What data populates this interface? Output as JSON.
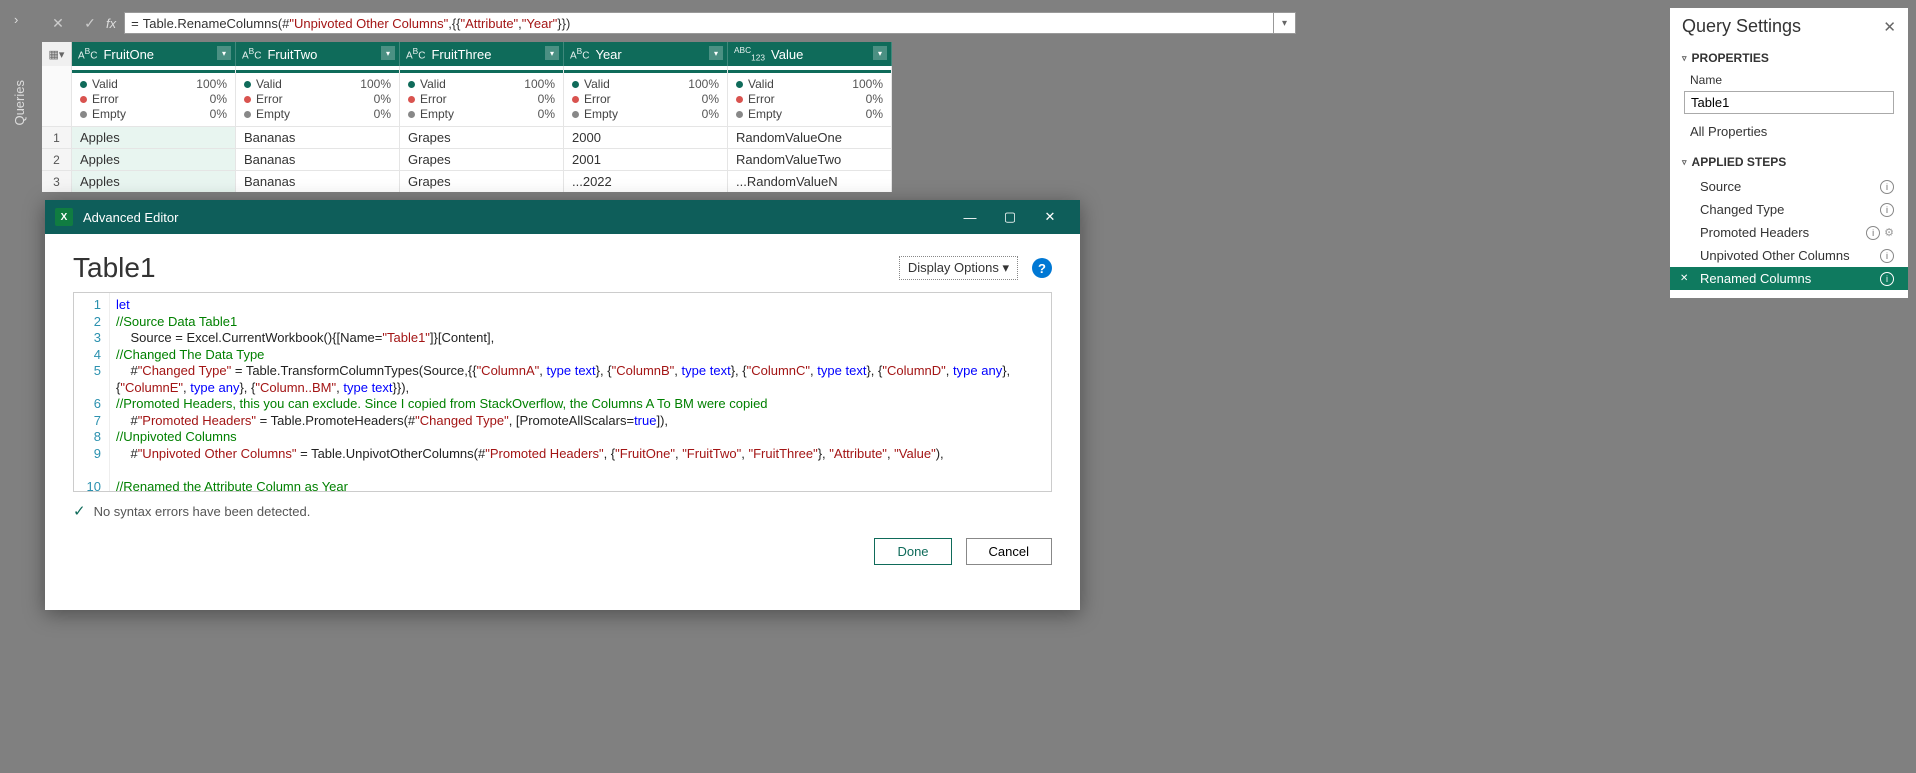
{
  "sidebar": {
    "queries_label": "Queries"
  },
  "formula_bar": {
    "fx": "fx",
    "prefix": "= ",
    "fn1": "Table.RenameColumns(#",
    "str1": "\"Unpivoted Other Columns\"",
    "mid": ",{{",
    "str2": "\"Attribute\"",
    "sep": ", ",
    "str3": "\"Year\"",
    "end": "}})"
  },
  "columns": [
    {
      "type": "ABC",
      "name": "FruitOne"
    },
    {
      "type": "ABC",
      "name": "FruitTwo"
    },
    {
      "type": "ABC",
      "name": "FruitThree"
    },
    {
      "type": "ABC",
      "name": "Year"
    },
    {
      "type": "ABC123",
      "name": "Value"
    }
  ],
  "quality": {
    "valid_label": "Valid",
    "valid_pct": "100%",
    "error_label": "Error",
    "error_pct": "0%",
    "empty_label": "Empty",
    "empty_pct": "0%"
  },
  "rows": [
    {
      "n": "1",
      "c": [
        "Apples",
        "Bananas",
        "Grapes",
        "2000",
        "RandomValueOne"
      ]
    },
    {
      "n": "2",
      "c": [
        "Apples",
        "Bananas",
        "Grapes",
        "2001",
        "RandomValueTwo"
      ]
    },
    {
      "n": "3",
      "c": [
        "Apples",
        "Bananas",
        "Grapes",
        "...2022",
        "...RandomValueN"
      ]
    }
  ],
  "editor": {
    "title": "Advanced Editor",
    "table_name": "Table1",
    "display_options": "Display Options",
    "code_lines": [
      "let",
      "//Source Data Table1",
      "    Source = Excel.CurrentWorkbook(){[Name=\"Table1\"]}[Content],",
      "//Changed The Data Type",
      "    #\"Changed Type\" = Table.TransformColumnTypes(Source,{{\"ColumnA\", type text}, {\"ColumnB\", type text}, {\"ColumnC\", type text}, {\"ColumnD\", type any}, {\"ColumnE\", type any}, {\"Column..BM\", type text}}),",
      "//Promoted Headers, this you can exclude. Since I copied from StackOverflow, the Columns A To BM were copied",
      "    #\"Promoted Headers\" = Table.PromoteHeaders(#\"Changed Type\", [PromoteAllScalars=true]),",
      "//Unpivoted Columns",
      "    #\"Unpivoted Other Columns\" = Table.UnpivotOtherColumns(#\"Promoted Headers\", {\"FruitOne\", \"FruitTwo\", \"FruitThree\"}, \"Attribute\", \"Value\"),",
      "//Renamed the Attribute Column as Year"
    ],
    "status": "No syntax errors have been detected.",
    "done": "Done",
    "cancel": "Cancel"
  },
  "query_settings": {
    "title": "Query Settings",
    "properties": "PROPERTIES",
    "name_label": "Name",
    "name_value": "Table1",
    "all_properties": "All Properties",
    "applied_steps": "APPLIED STEPS",
    "steps": [
      {
        "label": "Source",
        "info": true
      },
      {
        "label": "Changed Type",
        "info": true
      },
      {
        "label": "Promoted Headers",
        "info": true,
        "gear": true
      },
      {
        "label": "Unpivoted Other Columns",
        "info": true
      },
      {
        "label": "Renamed Columns",
        "info": true,
        "active": true
      }
    ]
  }
}
